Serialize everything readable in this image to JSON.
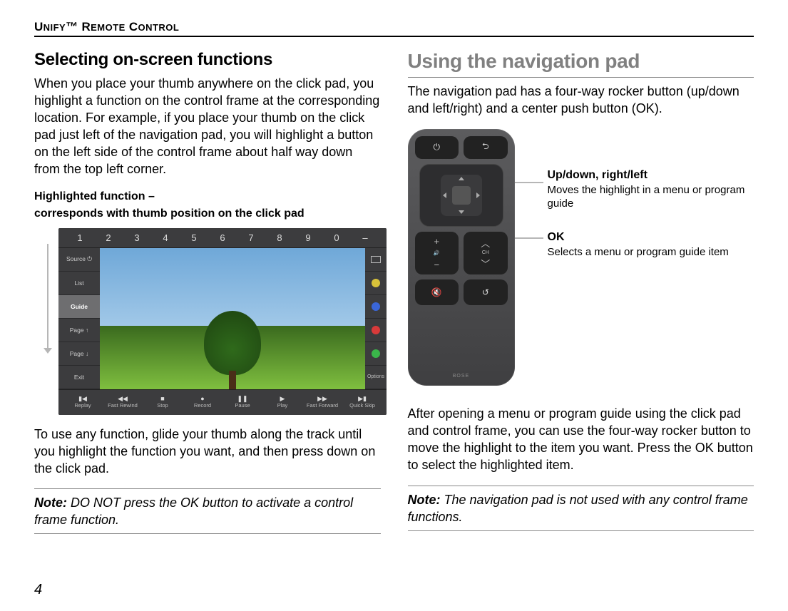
{
  "header": {
    "brand_strong": "U",
    "brand_rest": "NIFY",
    "tm": "™ R",
    "rest2": "EMOTE",
    "rest3": " C",
    "rest4": "ONTROL"
  },
  "left": {
    "h": "Selecting on-screen functions",
    "p1": "When you place your thumb anywhere on the click pad, you highlight a function on the control frame at the corresponding location. For example, if you place your thumb on the click pad just left of the navigation pad, you will highlight a button on the left side of the control frame about half way down from the top left corner.",
    "callout_l1": "Highlighted function –",
    "callout_l2": "corresponds with thumb position on the click pad",
    "tv": {
      "digits": [
        "1",
        "2",
        "3",
        "4",
        "5",
        "6",
        "7",
        "8",
        "9",
        "0",
        "–"
      ],
      "left_items": [
        "Source ⏻",
        "List",
        "Guide",
        "Page ↑",
        "Page ↓",
        "Exit"
      ],
      "selected_index": 2,
      "right_last": "Options",
      "bottom": [
        {
          "ic": "▮◀",
          "lbl": "Replay"
        },
        {
          "ic": "◀◀",
          "lbl": "Fast Rewind"
        },
        {
          "ic": "■",
          "lbl": "Stop"
        },
        {
          "ic": "●",
          "lbl": "Record"
        },
        {
          "ic": "❚❚",
          "lbl": "Pause"
        },
        {
          "ic": "▶",
          "lbl": "Play"
        },
        {
          "ic": "▶▶",
          "lbl": "Fast Forward"
        },
        {
          "ic": "▶▮",
          "lbl": "Quick Skip"
        }
      ]
    },
    "p2": "To use any function, glide your thumb along the track until you highlight the function you want, and then press down on the click pad.",
    "note_b": "Note:",
    "note_i": " DO NOT press the OK button to activate a control frame function."
  },
  "right": {
    "h": "Using the navigation pad",
    "p1": "The navigation pad has a four-way rocker button (up/down and left/right) and a center push button (OK).",
    "label1_b": "Up/down, right/left",
    "label1_t": "Moves the highlight in a menu or program guide",
    "label2_b": "OK",
    "label2_t": "Selects a menu or program guide item",
    "remote": {
      "ch": "CH",
      "brand": "BOSE"
    },
    "p2": "After opening a menu or program guide using the click pad and control frame, you can use the four-way rocker button to move the highlight to the item you want. Press the OK button to select the highlighted item.",
    "note_b": "Note:",
    "note_i": " The navigation pad is not used with any control frame functions."
  },
  "page": "4"
}
